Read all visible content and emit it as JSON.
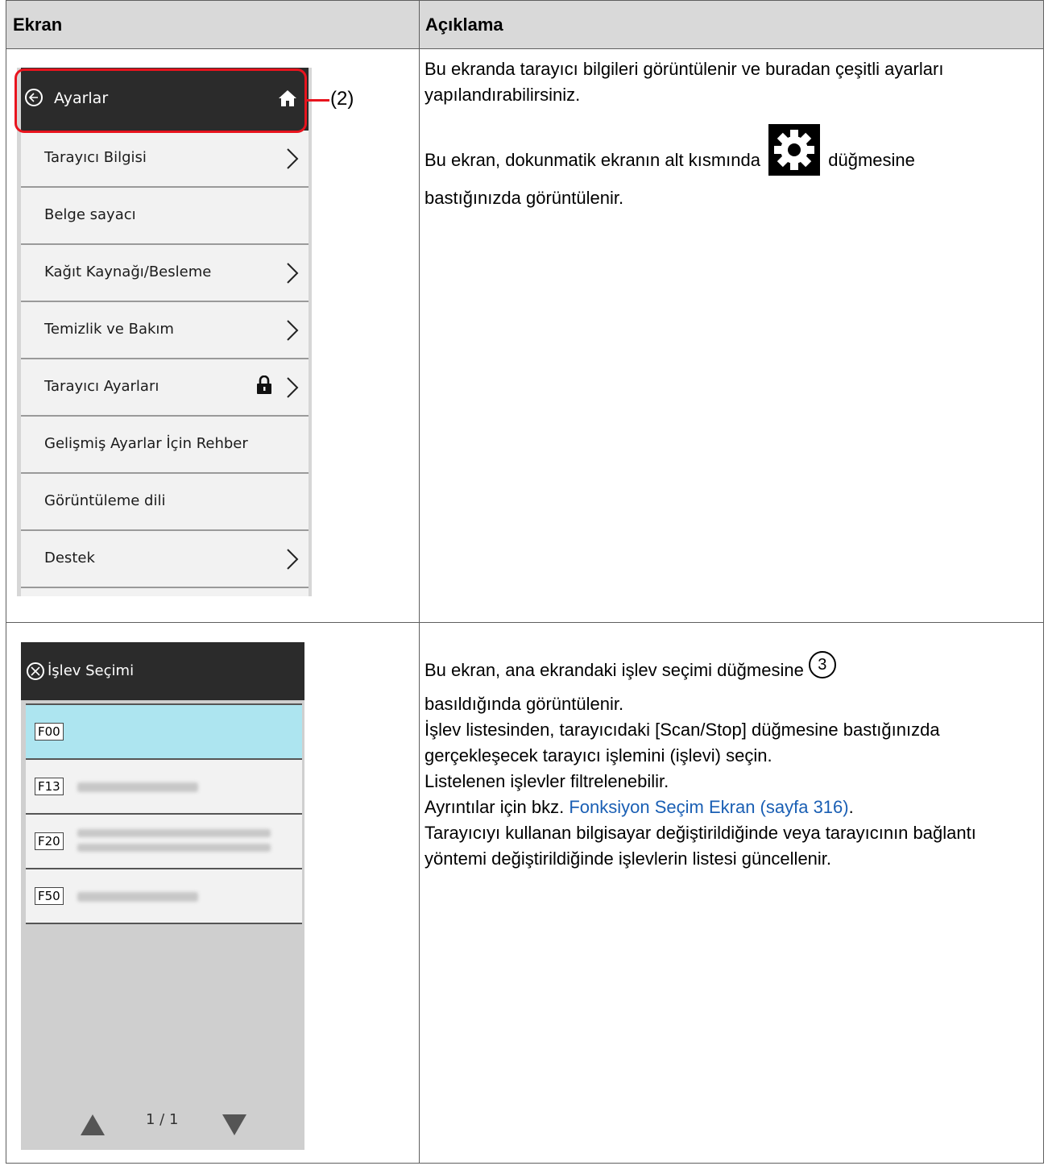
{
  "table": {
    "col1_header": "Ekran",
    "col2_header": "Açıklama"
  },
  "row1": {
    "settings_screen": {
      "title": "Ayarlar",
      "items": [
        {
          "label": "Tarayıcı Bilgisi",
          "chevron": true
        },
        {
          "label": "Belge sayacı",
          "chevron": false
        },
        {
          "label": "Kağıt Kaynağı/Besleme",
          "chevron": true
        },
        {
          "label": "Temizlik ve Bakım",
          "chevron": true
        },
        {
          "label": "Tarayıcı Ayarları",
          "chevron": true,
          "lock": true
        },
        {
          "label": "Gelişmiş Ayarlar İçin Rehber",
          "chevron": false
        },
        {
          "label": "Görüntüleme dili",
          "chevron": false
        },
        {
          "label": "Destek",
          "chevron": true
        }
      ]
    },
    "callout": "(2)",
    "desc_p1": "Bu ekranda tarayıcı bilgileri görüntülenir ve buradan çeşitli ayarları yapılandırabilirsiniz.",
    "desc_p2_before": "Bu ekran, dokunmatik ekranın alt kısmında",
    "desc_p2_after": "düğmesine",
    "desc_p2_line2": "bastığınızda görüntülenir."
  },
  "row2": {
    "fsel_screen": {
      "title": "İşlev Seçimi",
      "items": [
        {
          "key": "F00",
          "selected": true
        },
        {
          "key": "F13",
          "selected": false
        },
        {
          "key": "F20",
          "selected": false
        },
        {
          "key": "F50",
          "selected": false
        }
      ],
      "page": "1 / 1"
    },
    "desc_line1": "Bu ekran, ana ekrandaki işlev seçimi düğmesine",
    "icon_num": "3",
    "desc_line2": "basıldığında görüntülenir.",
    "desc_line3": "İşlev listesinden, tarayıcıdaki [Scan/Stop] düğmesine bastığınızda gerçekleşecek tarayıcı işlemini (işlevi) seçin.",
    "desc_line4": "Listelenen işlevler filtrelenebilir.",
    "desc_line5_before": "Ayrıntılar için bkz.",
    "desc_link": "Fonksiyon Seçim Ekran (sayfa 316)",
    "desc_line5_after": ".",
    "desc_line6": "Tarayıcıyı kullanan bilgisayar değiştirildiğinde veya tarayıcının bağlantı yöntemi değiştirildiğinde işlevlerin listesi güncellenir."
  },
  "colors": {
    "header_bg": "#d9d9d9",
    "highlight_red": "#e8141e",
    "selected_row": "#ade5f0",
    "link": "#1a5fb4"
  }
}
